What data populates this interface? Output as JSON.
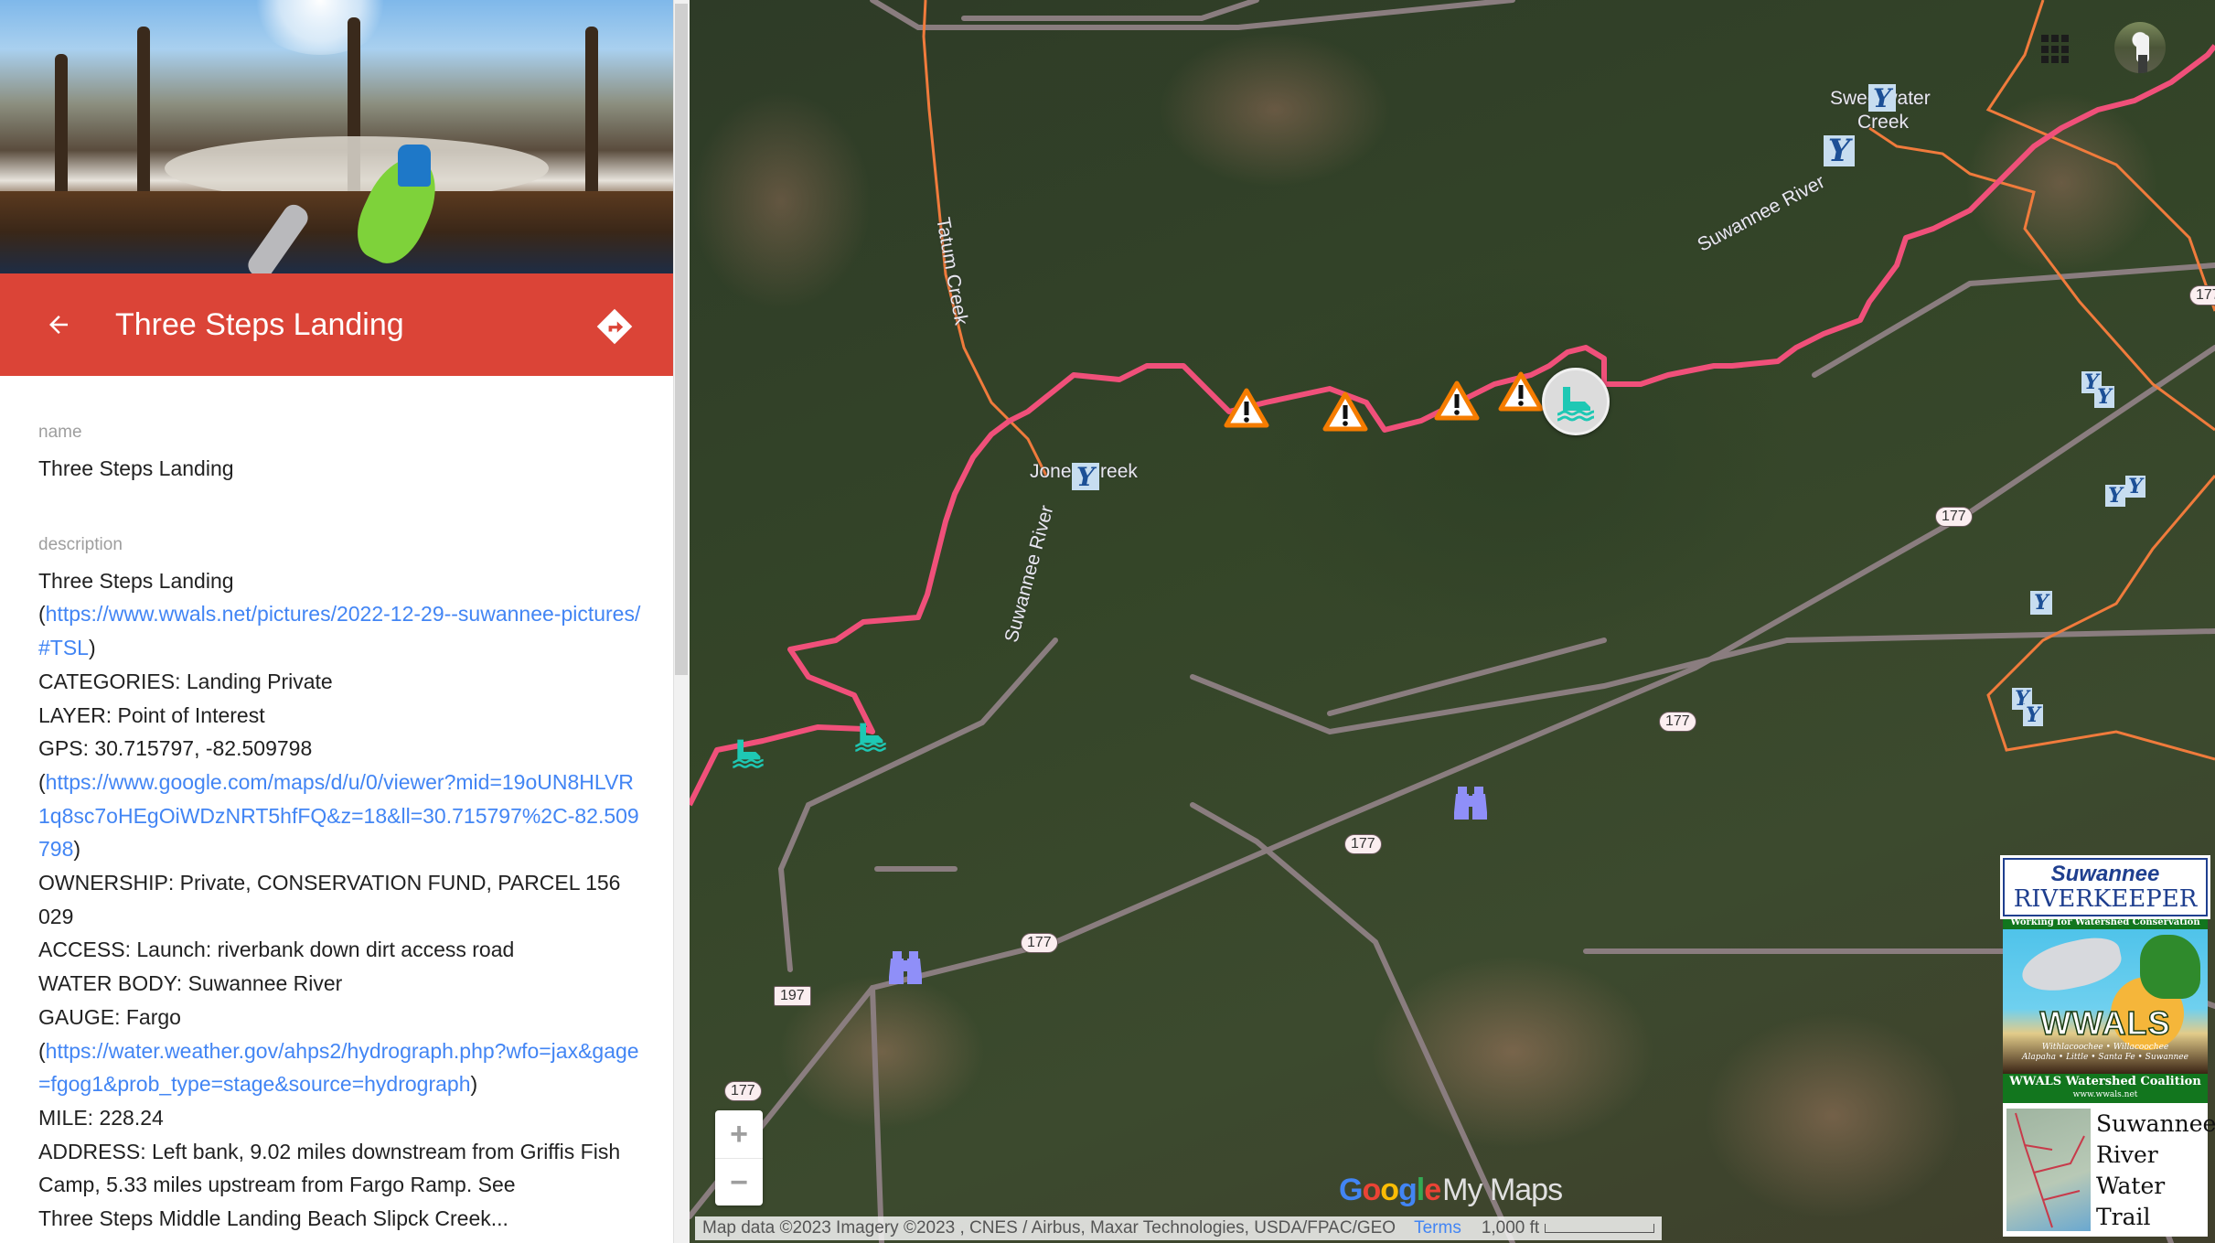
{
  "panel": {
    "title": "Three Steps Landing",
    "back_label": "Back",
    "directions_label": "Directions",
    "fields": {
      "name_label": "name",
      "name_value": "Three Steps Landing",
      "description_label": "description"
    },
    "description": {
      "line_title": "Three Steps Landing",
      "pictures_link": "https://www.wwals.net/pictures/2022-12-29--suwannee-pictures/#TSL",
      "categories": "CATEGORIES: Landing Private",
      "layer": "LAYER: Point of Interest",
      "gps": "GPS: 30.715797, -82.509798",
      "gps_link": "https://www.google.com/maps/d/u/0/viewer?mid=19oUN8HLVR1q8sc7oHEgOiWDzNRT5hfFQ&z=18&ll=30.715797%2C-82.509798",
      "ownership": "OWNERSHIP: Private, CONSERVATION FUND, PARCEL 156 029",
      "access": "ACCESS: Launch: riverbank down dirt access road",
      "water_body": "WATER BODY: Suwannee River",
      "gauge": "GAUGE: Fargo",
      "gauge_link": "https://water.weather.gov/ahps2/hydrograph.php?wfo=jax&gage=fgog1&prob_type=stage&source=hydrograph",
      "mile": "MILE: 228.24",
      "address": "ADDRESS: Left bank, 9.02 miles downstream from Griffis Fish Camp, 5.33 miles upstream from Fargo Ramp. See",
      "address_cont": "Three Steps Middle Landing Beach Slipck Creek..."
    },
    "colors": {
      "header": "#db4437",
      "link": "#4285f4"
    }
  },
  "map": {
    "labels": {
      "sweetwater_creek_1": "Sweetwater",
      "sweetwater_creek_2": "Creek",
      "jones_creek": "Jones Creek",
      "tatum_creek": "Tatum Creek",
      "suwannee_river_upper": "Suwannee River",
      "suwannee_river_lower": "Suwannee River"
    },
    "road_shields": [
      "177",
      "177",
      "177",
      "177",
      "177",
      "197",
      "177"
    ],
    "markers": {
      "selected": "Three Steps Landing (launch)",
      "warnings": 4,
      "launches": 2,
      "binoculars": 2,
      "confluences": 10
    },
    "zoom_in": "+",
    "zoom_out": "−",
    "logo_google": [
      "G",
      "o",
      "o",
      "g",
      "l",
      "e"
    ],
    "logo_mymaps": "My Maps",
    "attribution": "Map data ©2023 Imagery ©2023 , CNES / Airbus, Maxar Technologies, USDA/FPAC/GEO",
    "terms": "Terms",
    "scale": "1,000 ft",
    "colors": {
      "river_trail": "#f0507a",
      "creek": "#f07b3c",
      "warning": "#f57c00",
      "launch": "#1ec8b4",
      "binoculars": "#8f8ff8"
    }
  },
  "legend": {
    "riverkeeper_1": "Suwannee",
    "riverkeeper_2": "RIVERKEEPER",
    "tagline": "Working for Watershed Conservation",
    "wwals": "WWALS",
    "rivers_1": "Withlacoochee • Willacoochee",
    "rivers_2": "Alapaha • Little • Santa Fe • Suwannee",
    "coalition": "WWALS Watershed Coalition",
    "website": "www.wwals.net",
    "trail_1": "Suwannee",
    "trail_2": "River",
    "trail_3": "Water",
    "trail_4": "Trail"
  }
}
